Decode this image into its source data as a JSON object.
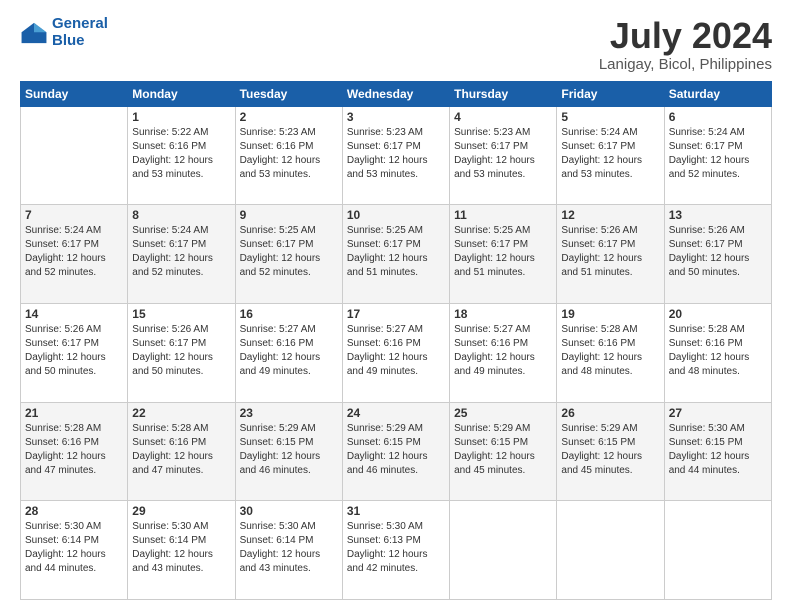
{
  "header": {
    "logo_general": "General",
    "logo_blue": "Blue",
    "title": "July 2024",
    "subtitle": "Lanigay, Bicol, Philippines"
  },
  "calendar": {
    "days_of_week": [
      "Sunday",
      "Monday",
      "Tuesday",
      "Wednesday",
      "Thursday",
      "Friday",
      "Saturday"
    ],
    "weeks": [
      [
        {
          "day": "",
          "info": ""
        },
        {
          "day": "1",
          "info": "Sunrise: 5:22 AM\nSunset: 6:16 PM\nDaylight: 12 hours\nand 53 minutes."
        },
        {
          "day": "2",
          "info": "Sunrise: 5:23 AM\nSunset: 6:16 PM\nDaylight: 12 hours\nand 53 minutes."
        },
        {
          "day": "3",
          "info": "Sunrise: 5:23 AM\nSunset: 6:17 PM\nDaylight: 12 hours\nand 53 minutes."
        },
        {
          "day": "4",
          "info": "Sunrise: 5:23 AM\nSunset: 6:17 PM\nDaylight: 12 hours\nand 53 minutes."
        },
        {
          "day": "5",
          "info": "Sunrise: 5:24 AM\nSunset: 6:17 PM\nDaylight: 12 hours\nand 53 minutes."
        },
        {
          "day": "6",
          "info": "Sunrise: 5:24 AM\nSunset: 6:17 PM\nDaylight: 12 hours\nand 52 minutes."
        }
      ],
      [
        {
          "day": "7",
          "info": "Sunrise: 5:24 AM\nSunset: 6:17 PM\nDaylight: 12 hours\nand 52 minutes."
        },
        {
          "day": "8",
          "info": "Sunrise: 5:24 AM\nSunset: 6:17 PM\nDaylight: 12 hours\nand 52 minutes."
        },
        {
          "day": "9",
          "info": "Sunrise: 5:25 AM\nSunset: 6:17 PM\nDaylight: 12 hours\nand 52 minutes."
        },
        {
          "day": "10",
          "info": "Sunrise: 5:25 AM\nSunset: 6:17 PM\nDaylight: 12 hours\nand 51 minutes."
        },
        {
          "day": "11",
          "info": "Sunrise: 5:25 AM\nSunset: 6:17 PM\nDaylight: 12 hours\nand 51 minutes."
        },
        {
          "day": "12",
          "info": "Sunrise: 5:26 AM\nSunset: 6:17 PM\nDaylight: 12 hours\nand 51 minutes."
        },
        {
          "day": "13",
          "info": "Sunrise: 5:26 AM\nSunset: 6:17 PM\nDaylight: 12 hours\nand 50 minutes."
        }
      ],
      [
        {
          "day": "14",
          "info": "Sunrise: 5:26 AM\nSunset: 6:17 PM\nDaylight: 12 hours\nand 50 minutes."
        },
        {
          "day": "15",
          "info": "Sunrise: 5:26 AM\nSunset: 6:17 PM\nDaylight: 12 hours\nand 50 minutes."
        },
        {
          "day": "16",
          "info": "Sunrise: 5:27 AM\nSunset: 6:16 PM\nDaylight: 12 hours\nand 49 minutes."
        },
        {
          "day": "17",
          "info": "Sunrise: 5:27 AM\nSunset: 6:16 PM\nDaylight: 12 hours\nand 49 minutes."
        },
        {
          "day": "18",
          "info": "Sunrise: 5:27 AM\nSunset: 6:16 PM\nDaylight: 12 hours\nand 49 minutes."
        },
        {
          "day": "19",
          "info": "Sunrise: 5:28 AM\nSunset: 6:16 PM\nDaylight: 12 hours\nand 48 minutes."
        },
        {
          "day": "20",
          "info": "Sunrise: 5:28 AM\nSunset: 6:16 PM\nDaylight: 12 hours\nand 48 minutes."
        }
      ],
      [
        {
          "day": "21",
          "info": "Sunrise: 5:28 AM\nSunset: 6:16 PM\nDaylight: 12 hours\nand 47 minutes."
        },
        {
          "day": "22",
          "info": "Sunrise: 5:28 AM\nSunset: 6:16 PM\nDaylight: 12 hours\nand 47 minutes."
        },
        {
          "day": "23",
          "info": "Sunrise: 5:29 AM\nSunset: 6:15 PM\nDaylight: 12 hours\nand 46 minutes."
        },
        {
          "day": "24",
          "info": "Sunrise: 5:29 AM\nSunset: 6:15 PM\nDaylight: 12 hours\nand 46 minutes."
        },
        {
          "day": "25",
          "info": "Sunrise: 5:29 AM\nSunset: 6:15 PM\nDaylight: 12 hours\nand 45 minutes."
        },
        {
          "day": "26",
          "info": "Sunrise: 5:29 AM\nSunset: 6:15 PM\nDaylight: 12 hours\nand 45 minutes."
        },
        {
          "day": "27",
          "info": "Sunrise: 5:30 AM\nSunset: 6:15 PM\nDaylight: 12 hours\nand 44 minutes."
        }
      ],
      [
        {
          "day": "28",
          "info": "Sunrise: 5:30 AM\nSunset: 6:14 PM\nDaylight: 12 hours\nand 44 minutes."
        },
        {
          "day": "29",
          "info": "Sunrise: 5:30 AM\nSunset: 6:14 PM\nDaylight: 12 hours\nand 43 minutes."
        },
        {
          "day": "30",
          "info": "Sunrise: 5:30 AM\nSunset: 6:14 PM\nDaylight: 12 hours\nand 43 minutes."
        },
        {
          "day": "31",
          "info": "Sunrise: 5:30 AM\nSunset: 6:13 PM\nDaylight: 12 hours\nand 42 minutes."
        },
        {
          "day": "",
          "info": ""
        },
        {
          "day": "",
          "info": ""
        },
        {
          "day": "",
          "info": ""
        }
      ]
    ]
  }
}
